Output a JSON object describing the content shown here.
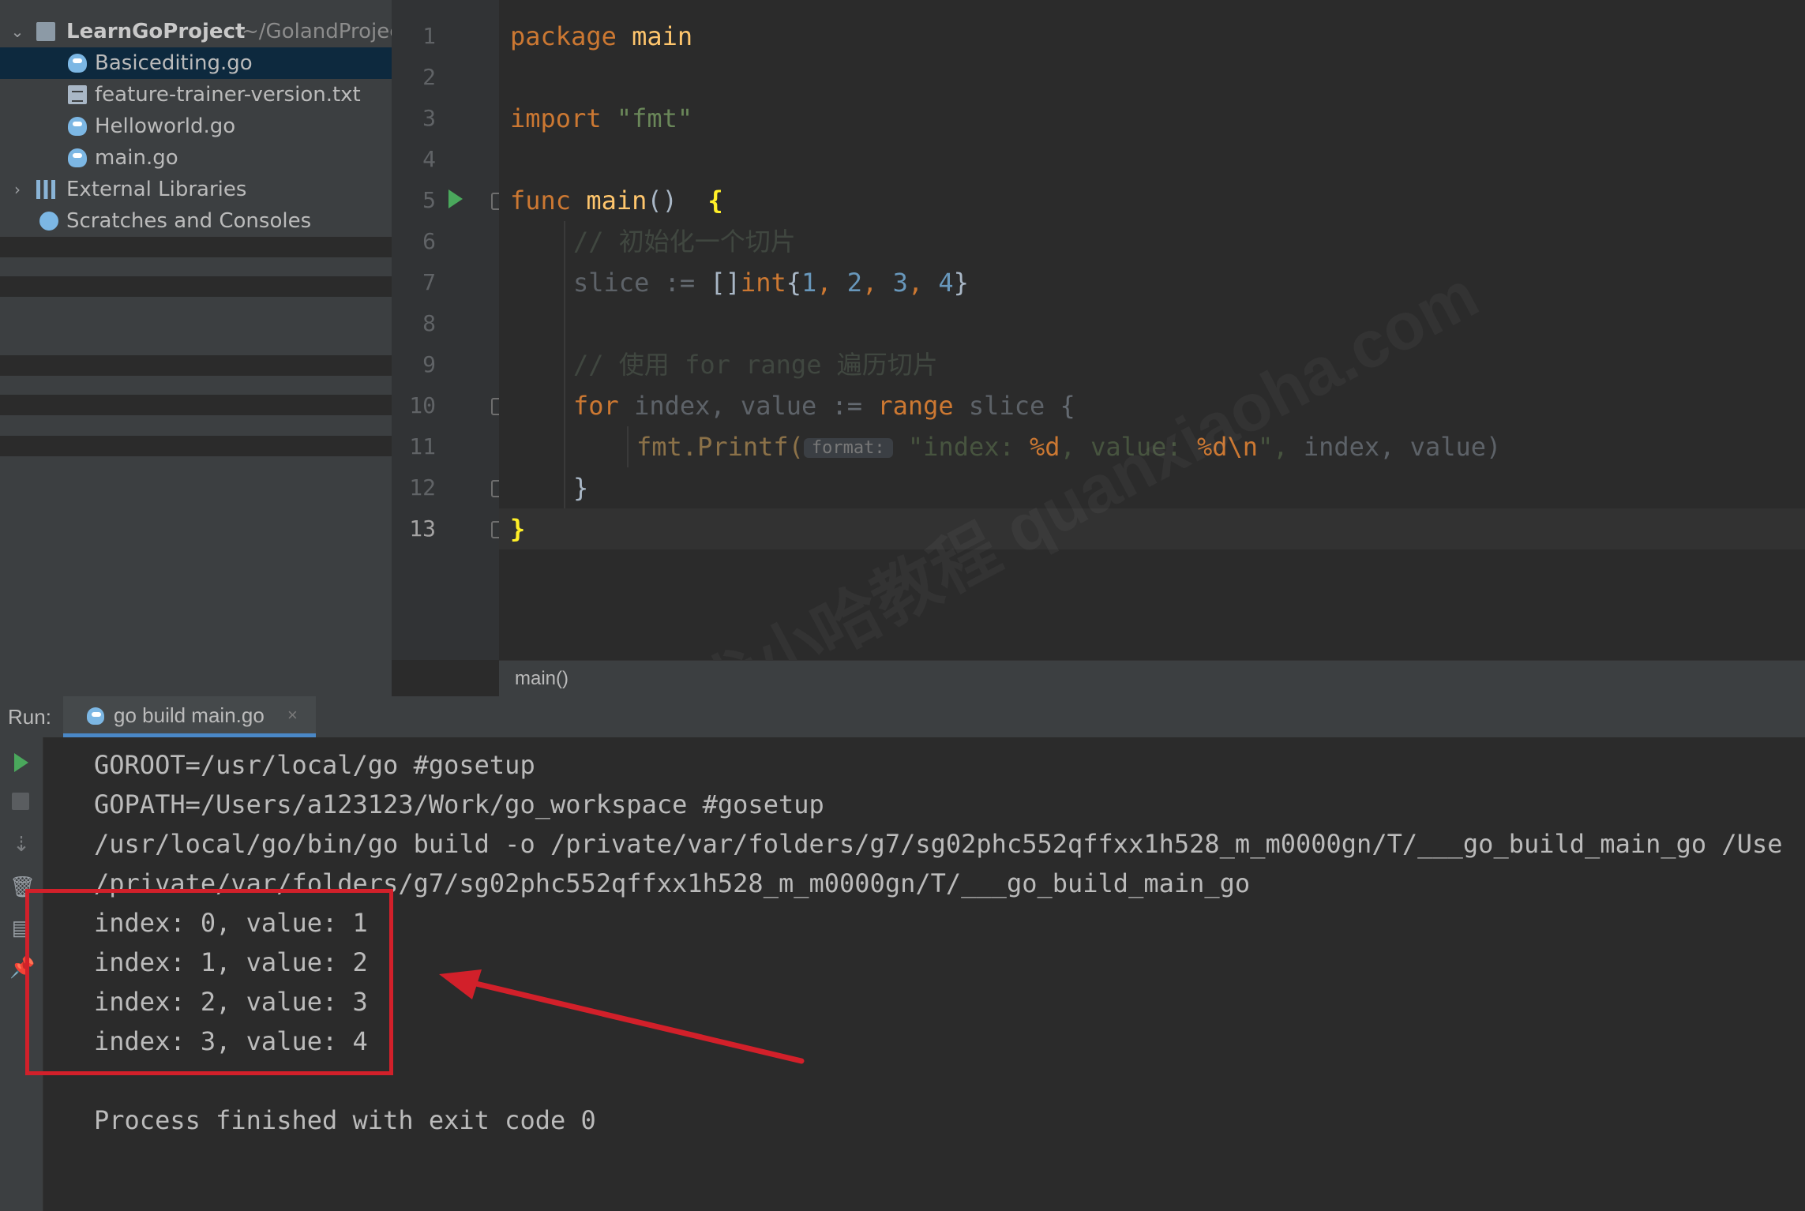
{
  "project": {
    "root_name": "LearnGoProject",
    "root_path": "~/GolandProjec",
    "files": [
      "Basicediting.go",
      "feature-trainer-version.txt",
      "Helloworld.go",
      "main.go"
    ],
    "external_libraries": "External Libraries",
    "scratches": "Scratches and Consoles"
  },
  "editor": {
    "line_numbers": [
      "1",
      "2",
      "3",
      "4",
      "5",
      "6",
      "7",
      "8",
      "9",
      "10",
      "11",
      "12",
      "13"
    ],
    "code": {
      "l1_kw": "package",
      "l1_name": "main",
      "l3_kw": "import",
      "l3_str": "\"fmt\"",
      "l5_kw": "func",
      "l5_fn": "main",
      "l5_paren": "()",
      "l5_brace": "{",
      "l6_comment": "// 初始化一个切片",
      "l7_var": "slice",
      "l7_op": ":=",
      "l7_type_open": "[]",
      "l7_type": "int",
      "l7_brace_open": "{",
      "l7_nums": [
        "1",
        "2",
        "3",
        "4"
      ],
      "l7_brace_close": "}",
      "l9_comment": "// 使用 for range 遍历切片",
      "l10_kw": "for",
      "l10_vars": "index, value",
      "l10_op": ":=",
      "l10_range": "range",
      "l10_slice": "slice",
      "l10_brace": "{",
      "l11_fn": "fmt.Printf(",
      "l11_hint": "format:",
      "l11_str_a": "\"index:",
      "l11_pd1": "%d",
      "l11_str_b": ", value:",
      "l11_pd2": "%d\\n",
      "l11_str_c": "\",",
      "l11_args": "index, value)",
      "l12_brace": "}",
      "l13_brace": "}"
    }
  },
  "breadcrumb": "main()",
  "run": {
    "label": "Run:",
    "tab_label": "go build main.go",
    "tab_close": "×",
    "console_lines": [
      "GOROOT=/usr/local/go #gosetup",
      "GOPATH=/Users/a123123/Work/go_workspace #gosetup",
      "/usr/local/go/bin/go build -o /private/var/folders/g7/sg02phc552qffxx1h528_m_m0000gn/T/___go_build_main_go /Use",
      "/private/var/folders/g7/sg02phc552qffxx1h528_m_m0000gn/T/___go_build_main_go",
      "index: 0, value: 1",
      "index: 1, value: 2",
      "index: 2, value: 3",
      "index: 3, value: 4",
      "",
      "Process finished with exit code 0"
    ]
  },
  "watermark": "犬小哈教程 quanxiaoha.com",
  "colors": {
    "keyword": "#cc7832",
    "function": "#ffc66d",
    "string": "#6a8759",
    "number": "#6897bb",
    "highlight_box": "#d2202a"
  }
}
